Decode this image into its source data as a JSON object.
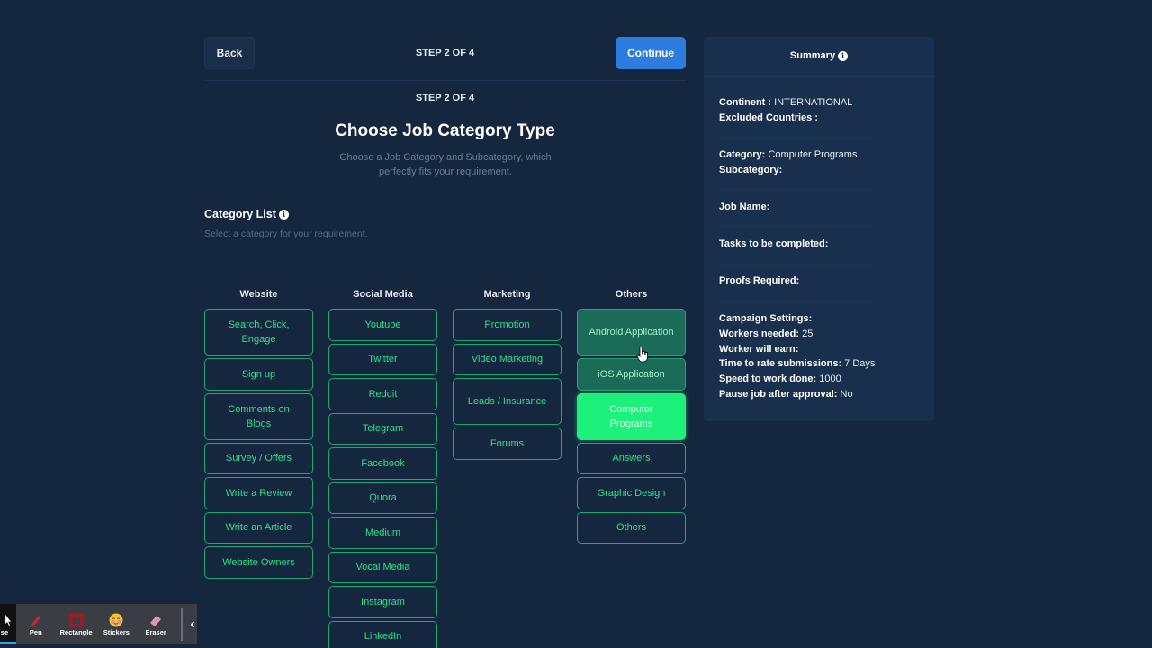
{
  "header": {
    "back_label": "Back",
    "step_label": "STEP 2 OF 4",
    "continue_label": "Continue"
  },
  "main": {
    "step_label": "STEP 2 OF 4",
    "title": "Choose Job Category Type",
    "description": "Choose a Job Category and Subcategory, which perfectly fits your requirement.",
    "category_list_title": "Category List",
    "category_list_subtitle": "Select a category for your requirement.",
    "columns": [
      {
        "heading": "Website",
        "items": [
          "Search, Click, Engage",
          "Sign up",
          "Comments on Blogs",
          "Survey / Offers",
          "Write a Review",
          "Write an Article",
          "Website Owners"
        ]
      },
      {
        "heading": "Social Media",
        "items": [
          "Youtube",
          "Twitter",
          "Reddit",
          "Telegram",
          "Facebook",
          "Quora",
          "Medium",
          "Vocal Media",
          "Instagram",
          "LinkedIn"
        ]
      },
      {
        "heading": "Marketing",
        "items": [
          "Promotion",
          "Video Marketing",
          "Leads / Insurance",
          "Forums"
        ]
      },
      {
        "heading": "Others",
        "items": [
          "Android Application",
          "iOS Application",
          "Computer Programs",
          "Answers",
          "Graphic Design",
          "Others"
        ]
      }
    ],
    "selected_category": "Computer Programs",
    "hovered_items": [
      "Android Application",
      "iOS Application"
    ]
  },
  "summary": {
    "title": "Summary",
    "continent_label": "Continent :",
    "continent_value": "INTERNATIONAL",
    "excluded_label": "Excluded Countries :",
    "excluded_value": "",
    "category_label": "Category:",
    "category_value": "Computer Programs",
    "subcategory_label": "Subcategory:",
    "subcategory_value": "",
    "job_name_label": "Job Name:",
    "tasks_label": "Tasks to be completed:",
    "proofs_label": "Proofs Required:",
    "campaign_label": "Campaign Settings:",
    "workers_label": "Workers needed:",
    "workers_value": "25",
    "earn_label": "Worker will earn:",
    "earn_value": "",
    "rate_label": "Time to rate submissions:",
    "rate_value": "7 Days",
    "speed_label": "Speed to work done:",
    "speed_value": "1000",
    "pause_label": "Pause job after approval:",
    "pause_value": "No"
  },
  "annotation_toolbar": {
    "tools": [
      {
        "label": "se",
        "icon": "mouse-icon"
      },
      {
        "label": "Pen",
        "icon": "pen-icon"
      },
      {
        "label": "Rectangle",
        "icon": "rectangle-icon"
      },
      {
        "label": "Stickers",
        "icon": "sticker-icon"
      },
      {
        "label": "Eraser",
        "icon": "eraser-icon"
      }
    ],
    "collapse_glyph": "‹"
  },
  "colors": {
    "background": "#15263f",
    "accent_blue": "#2f7ce0",
    "accent_green": "#2ee08b",
    "selected_green": "#1ef07c",
    "summary_bg": "#192f4e"
  }
}
